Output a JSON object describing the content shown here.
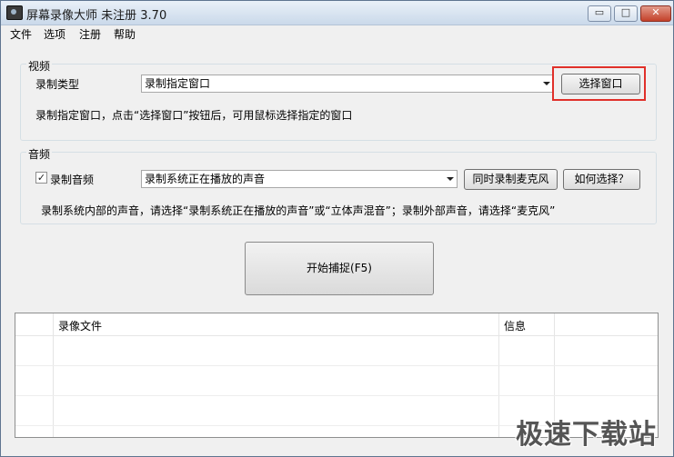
{
  "window": {
    "title": "屏幕录像大师 未注册 3.70",
    "min_icon": "▭",
    "max_icon": "□",
    "close_icon": "✕"
  },
  "menu": [
    "文件",
    "选项",
    "注册",
    "帮助"
  ],
  "video": {
    "group_label": "视频",
    "type_label": "录制类型",
    "type_value": "录制指定窗口",
    "select_window_button": "选择窗口",
    "hint": "录制指定窗口，点击“选择窗口”按钮后，可用鼠标选择指定的窗口"
  },
  "audio": {
    "group_label": "音频",
    "record_audio_label": "录制音频",
    "record_audio_checked": true,
    "source_value": "录制系统正在播放的声音",
    "mic_button": "同时录制麦克风",
    "how_button": "如何选择？",
    "hint": "录制系统内部的声音，请选择“录制系统正在播放的声音”或“立体声混音”；录制外部声音，请选择“麦克风”"
  },
  "capture_button": "开始捕捉(F5)",
  "table": {
    "columns": [
      "录像文件",
      "信息"
    ]
  },
  "watermark": "极速下载站",
  "colors": {
    "highlight": "#e0302a",
    "title_gradient_top": "#e9f0f8",
    "title_gradient_bottom": "#cad9ea"
  }
}
